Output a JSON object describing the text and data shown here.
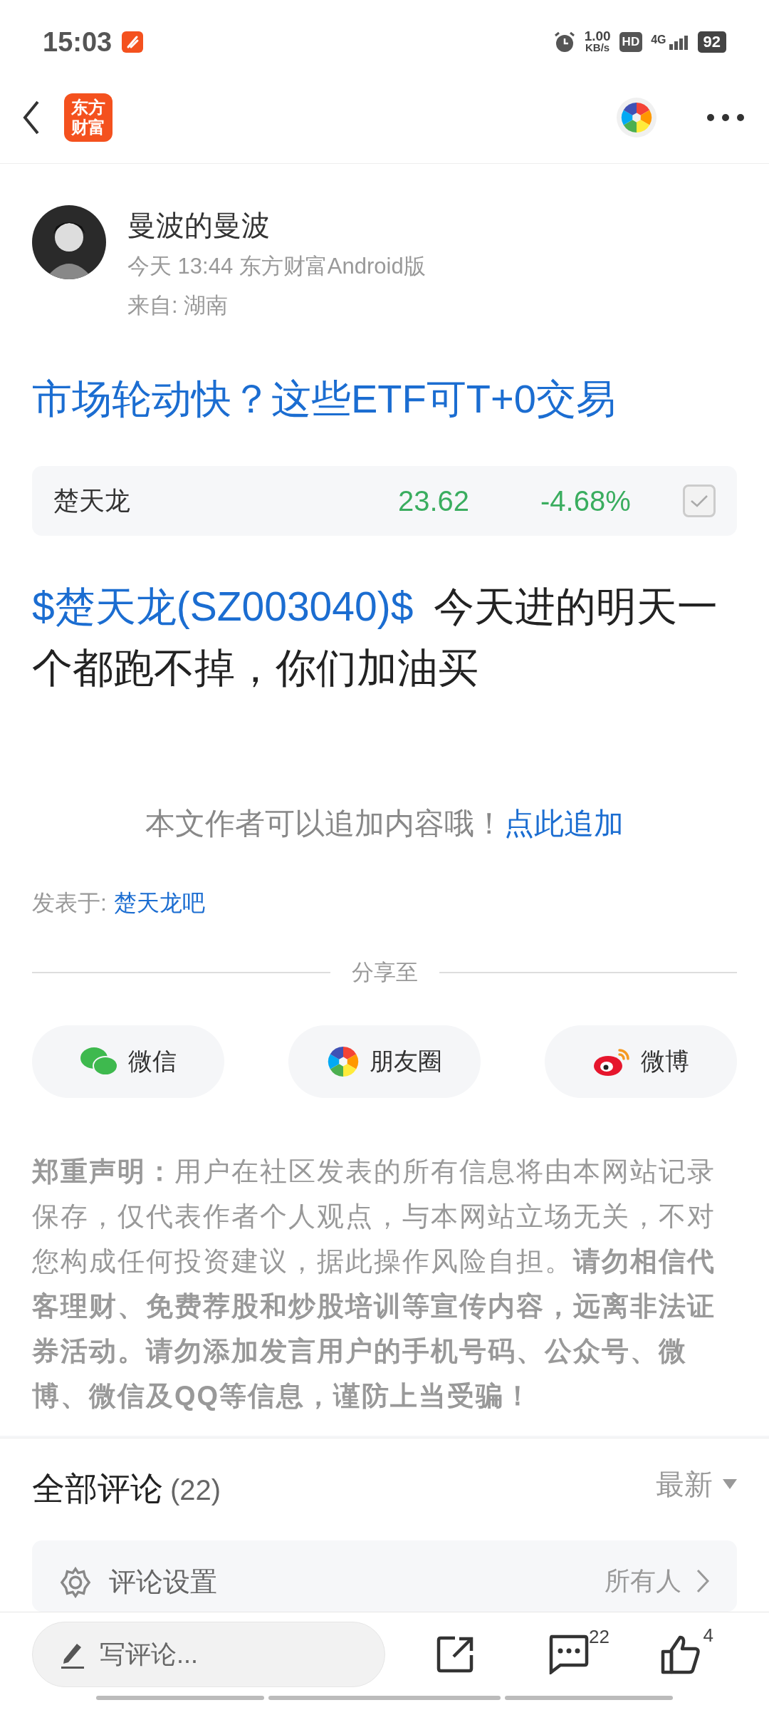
{
  "status_bar": {
    "time": "15:03",
    "net_speed": "1.00",
    "net_unit": "KB/s",
    "hd": "HD",
    "network": "4G",
    "battery": "92"
  },
  "header": {
    "logo_lines": [
      "东方",
      "财富"
    ]
  },
  "author": {
    "name": "曼波的曼波",
    "meta": "今天 13:44 东方财富Android版",
    "location": "来自: 湖南"
  },
  "title": "市场轮动快？这些ETF可T+0交易",
  "stock": {
    "name": "楚天龙",
    "price": "23.62",
    "change": "-4.68%",
    "checked": true
  },
  "post": {
    "stock_link": "$楚天龙(SZ003040)$",
    "text": "今天进的明天一个都跑不掉，你们加油买"
  },
  "append": {
    "text": "本文作者可以追加内容哦！",
    "link": "点此追加"
  },
  "posted_in": {
    "label": "发表于:",
    "forum": "楚天龙吧"
  },
  "share": {
    "label": "分享至",
    "targets": [
      {
        "kind": "wechat",
        "label": "微信"
      },
      {
        "kind": "moments",
        "label": "朋友圈"
      },
      {
        "kind": "weibo",
        "label": "微博"
      }
    ]
  },
  "disclaimer": "**郑重声明：**用户在社区发表的所有信息将由本网站记录保存，仅代表作者个人观点，与本网站立场无关，不对您构成任何投资建议，据此操作风险自担。**请勿相信代客理财、免费荐股和炒股培训等宣传内容，远离非法证券活动。请勿添加发言用户的手机号码、公众号、微博、微信及QQ等信息，谨防上当受骗！**",
  "comments": {
    "title": "全部评论",
    "count": "(22)",
    "sort": "最新",
    "settings_label": "评论设置",
    "settings_value": "所有人"
  },
  "bottom_bar": {
    "placeholder": "写评论...",
    "comment_count": "22",
    "like_count": "4"
  }
}
